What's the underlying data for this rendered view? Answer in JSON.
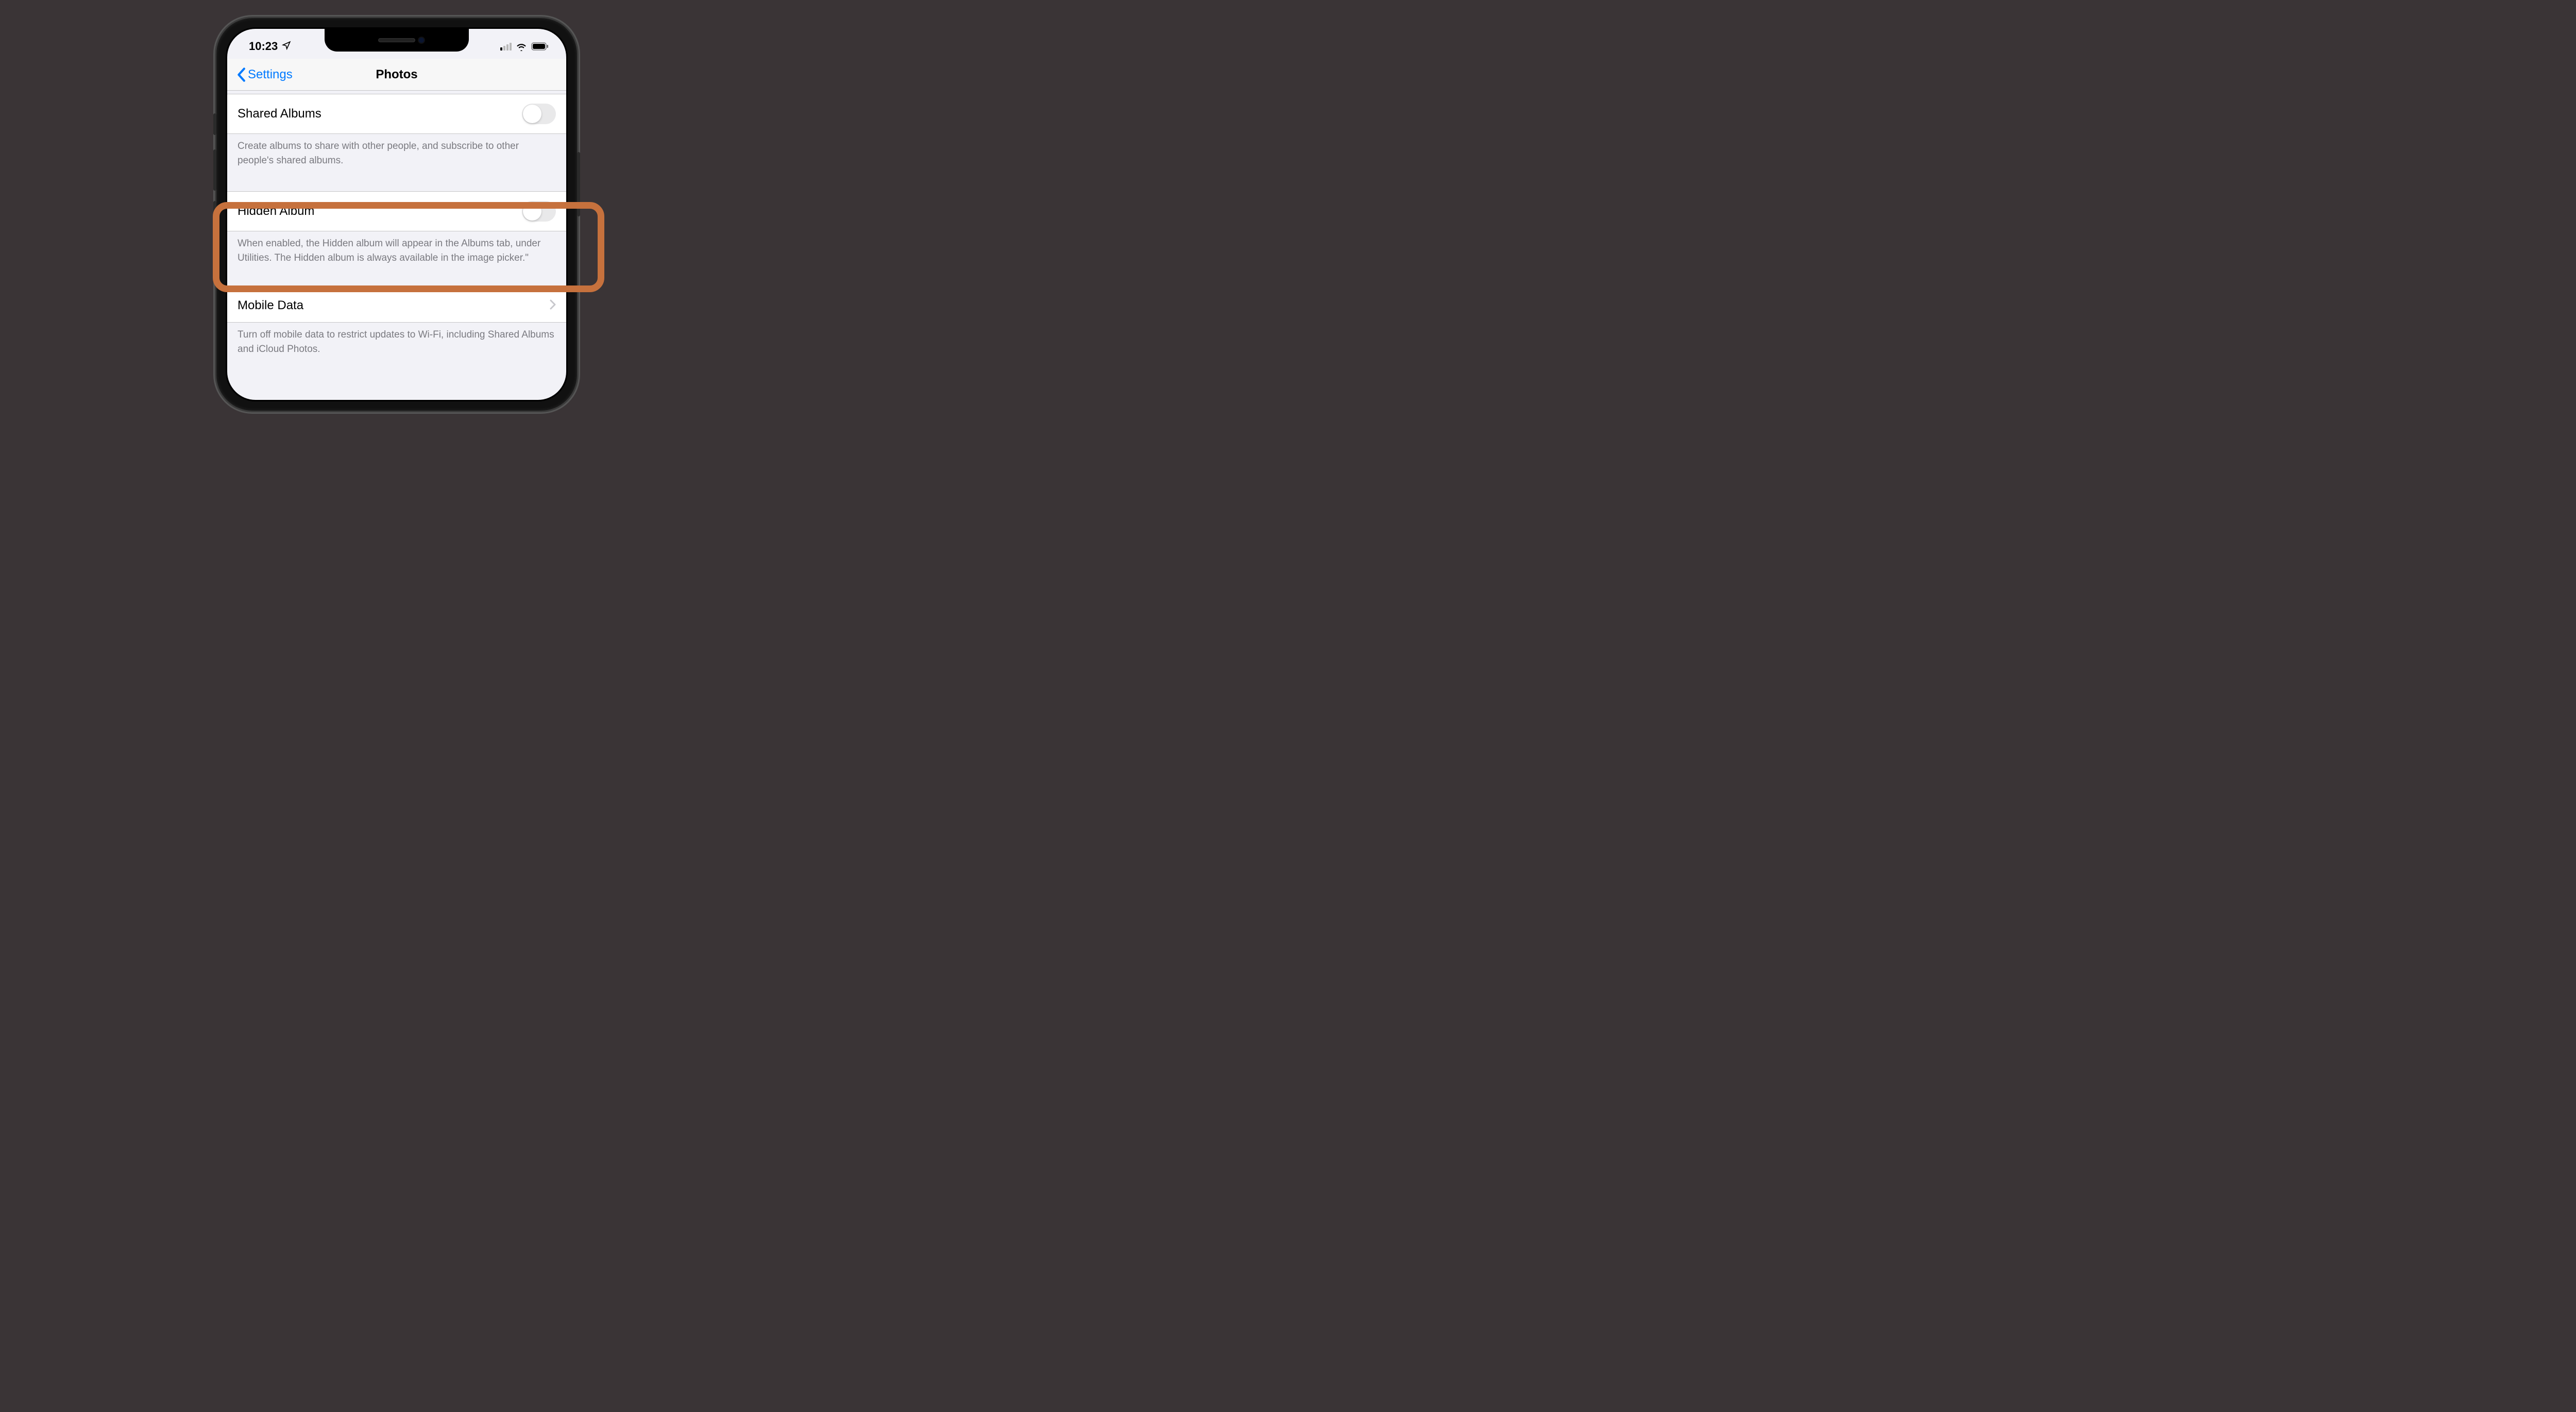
{
  "statusBar": {
    "time": "10:23",
    "locationIcon": "location-arrow",
    "signalStrength": 1,
    "wifi": true,
    "batteryLevel": 95
  },
  "nav": {
    "backLabel": "Settings",
    "title": "Photos"
  },
  "sections": {
    "sharedAlbums": {
      "label": "Shared Albums",
      "toggle": false,
      "footer": "Create albums to share with other people, and subscribe to other people's shared albums."
    },
    "hiddenAlbum": {
      "label": "Hidden Album",
      "toggle": false,
      "footer": "When enabled, the Hidden album will appear in the Albums tab, under Utilities. The Hidden album is always available in the image picker.\""
    },
    "mobileData": {
      "label": "Mobile Data",
      "footer": "Turn off mobile data to restrict updates to Wi-Fi, including Shared Albums and iCloud Photos."
    }
  },
  "highlight": {
    "target": "hidden-album-section",
    "color": "#c6713d"
  }
}
